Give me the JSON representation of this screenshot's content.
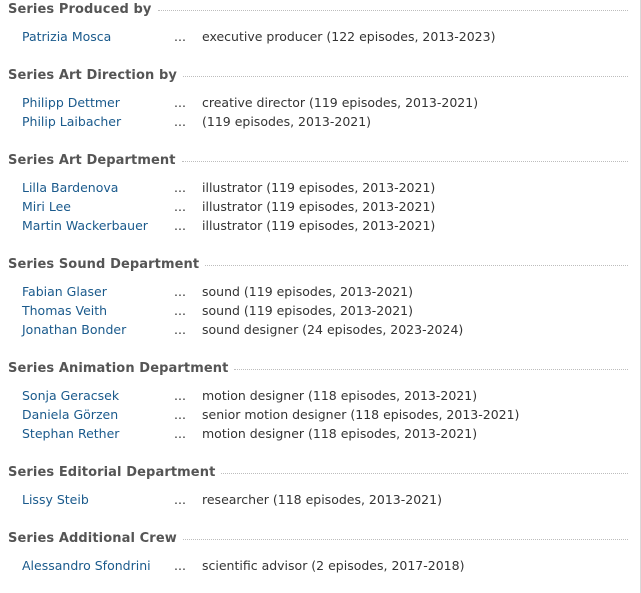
{
  "sections": [
    {
      "title": "Series Produced by",
      "rows": [
        {
          "name": "Patrizia Mosca",
          "credit": "executive producer (122 episodes, 2013-2023)"
        }
      ]
    },
    {
      "title": "Series Art Direction by",
      "rows": [
        {
          "name": "Philipp Dettmer",
          "credit": "creative director (119 episodes, 2013-2021)"
        },
        {
          "name": "Philip Laibacher",
          "credit": "(119 episodes, 2013-2021)"
        }
      ]
    },
    {
      "title": "Series Art Department",
      "rows": [
        {
          "name": "Lilla Bardenova",
          "credit": "illustrator (119 episodes, 2013-2021)"
        },
        {
          "name": "Miri Lee",
          "credit": "illustrator (119 episodes, 2013-2021)"
        },
        {
          "name": "Martin Wackerbauer",
          "credit": "illustrator (119 episodes, 2013-2021)"
        }
      ]
    },
    {
      "title": "Series Sound Department",
      "rows": [
        {
          "name": "Fabian Glaser",
          "credit": "sound (119 episodes, 2013-2021)"
        },
        {
          "name": "Thomas Veith",
          "credit": "sound (119 episodes, 2013-2021)"
        },
        {
          "name": "Jonathan Bonder",
          "credit": "sound designer (24 episodes, 2023-2024)"
        }
      ]
    },
    {
      "title": "Series Animation Department",
      "rows": [
        {
          "name": "Sonja Geracsek",
          "credit": "motion designer (118 episodes, 2013-2021)"
        },
        {
          "name": "Daniela Görzen",
          "credit": "senior motion designer (118 episodes, 2013-2021)"
        },
        {
          "name": "Stephan Rether",
          "credit": "motion designer (118 episodes, 2013-2021)"
        }
      ]
    },
    {
      "title": "Series Editorial Department",
      "rows": [
        {
          "name": "Lissy Steib",
          "credit": "researcher (118 episodes, 2013-2021)"
        }
      ]
    },
    {
      "title": "Series Additional Crew",
      "rows": [
        {
          "name": "Alessandro Sfondrini",
          "credit": "scientific advisor (2 episodes, 2017-2018)"
        }
      ]
    }
  ],
  "separator": "...",
  "colors": {
    "link": "#1a5a8c",
    "header": "#555555",
    "text": "#333333",
    "rule": "#bdbdbd"
  }
}
